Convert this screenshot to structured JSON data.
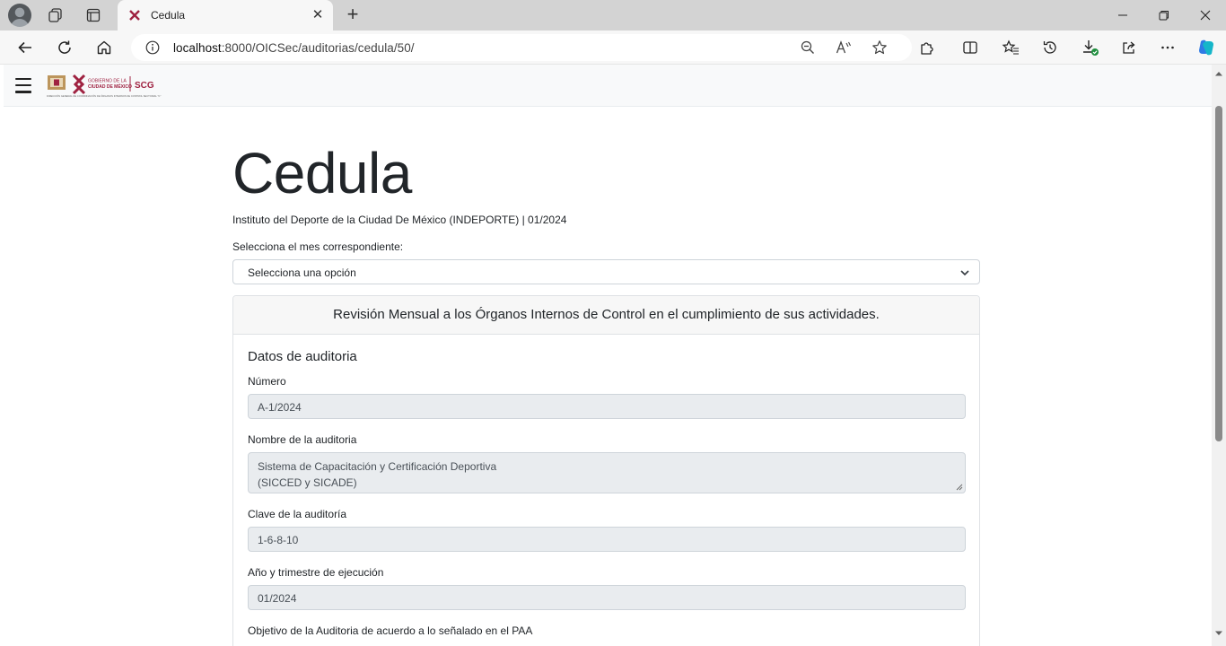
{
  "browser": {
    "tab_title": "Cedula",
    "url_host": "localhost",
    "url_rest": ":8000/OICSec/auditorias/cedula/50/"
  },
  "page": {
    "title": "Cedula",
    "subtitle": "Instituto del Deporte de la Ciudad De México (INDEPORTE) | 01/2024",
    "select_label": "Selecciona el mes correspondiente:",
    "select_value": "Selecciona una opción",
    "card_header": "Revisión Mensual a los Órganos Internos de Control en el cumplimiento de sus actividades.",
    "section_title": "Datos de auditoria",
    "fields": [
      {
        "label": "Número",
        "value": "A-1/2024"
      },
      {
        "label": "Nombre de la auditoria",
        "value_line1": "Sistema de Capacitación y Certificación Deportiva",
        "value_line2": "(SICCED y SICADE)"
      },
      {
        "label": "Clave de la auditoría",
        "value": "1-6-8-10"
      },
      {
        "label": "Año y trimestre de ejecución",
        "value": "01/2024"
      },
      {
        "label": "Objetivo de la Auditoria de acuerdo a lo señalado en el PAA"
      }
    ]
  },
  "logo": {
    "line1": "GOBIERNO DE LA",
    "line2": "CIUDAD DE MÉXICO",
    "acronym": "SCG",
    "caption": "DIRECCIÓN GENERAL DE COORDINACIÓN DE ÓRGANOS INTERNOS DE CONTROL SECTORIAL \"C\""
  },
  "colors": {
    "brand": "#9f2241",
    "gold": "#bc955c"
  }
}
